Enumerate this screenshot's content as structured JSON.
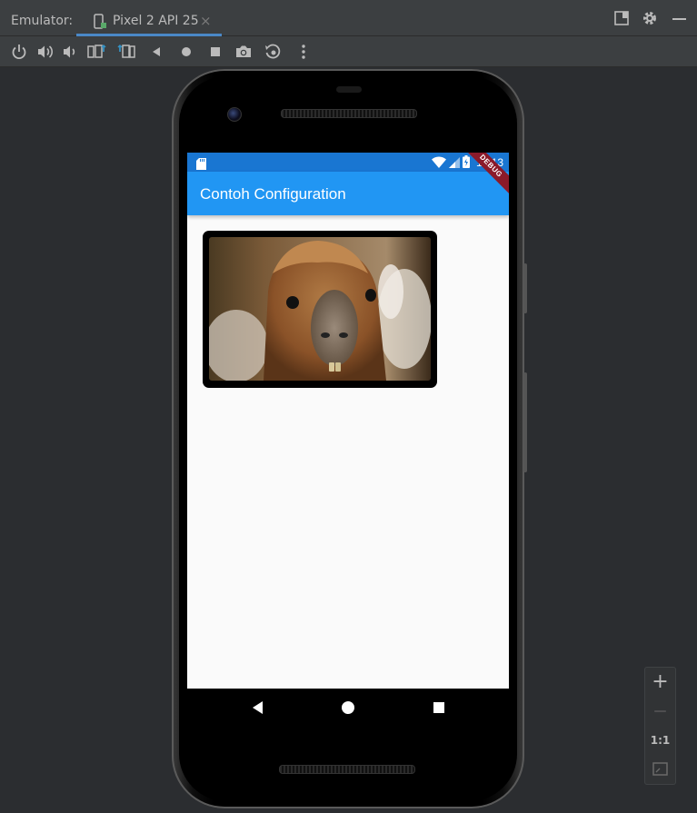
{
  "window": {
    "panel_label": "Emulator:",
    "device_tab": "Pixel 2 API 25",
    "tab_close": "×"
  },
  "toolbar": {
    "buttons": [
      "power-icon",
      "volume-up-icon",
      "volume-down-icon",
      "rotate-left-icon",
      "rotate-right-icon",
      "back-icon",
      "home-icon",
      "overview-icon",
      "camera-icon",
      "snapshot-icon",
      "more-icon"
    ]
  },
  "device": {
    "status_bar": {
      "time": "12:13"
    },
    "app_bar": {
      "title": "Contoh Configuration"
    },
    "debug_banner": "DEBUG",
    "image": {
      "subject": "llama photo"
    }
  },
  "zoom": {
    "zoom_in": "+",
    "zoom_out": "—",
    "actual_size": "1:1"
  },
  "colors": {
    "status_bar": "#1976d2",
    "app_bar": "#2196f3",
    "ide_background": "#2b2d30",
    "debug_banner": "#8b1a2a"
  }
}
